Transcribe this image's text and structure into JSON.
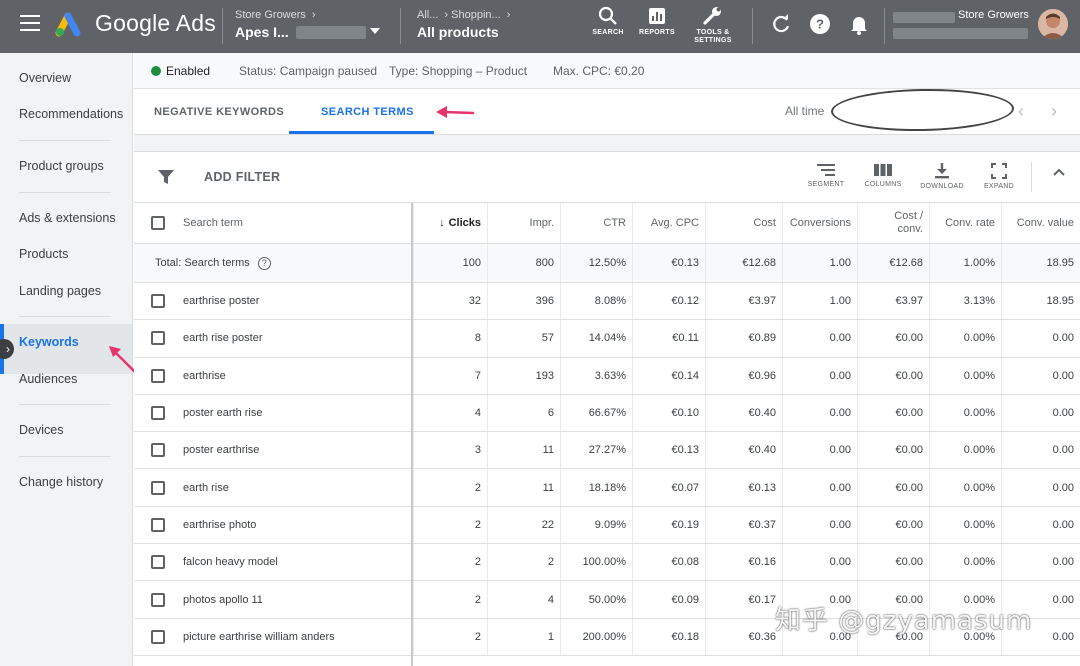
{
  "app": {
    "product_name": "Google Ads",
    "account_parent": "Store Growers",
    "account_name": "Apes I...",
    "campaign_parent": "All...",
    "campaign_child": "Shoppin...",
    "view_title": "All products",
    "user_account": "Store Growers"
  },
  "top_tools": {
    "search": "SEARCH",
    "reports": "REPORTS",
    "tools_line1": "TOOLS &",
    "tools_line2": "SETTINGS"
  },
  "sidebar": {
    "items": [
      {
        "label": "Overview"
      },
      {
        "label": "Recommendations"
      },
      {
        "label": "Product groups"
      },
      {
        "label": "Ads & extensions"
      },
      {
        "label": "Products"
      },
      {
        "label": "Landing pages"
      },
      {
        "label": "Keywords"
      },
      {
        "label": "Audiences"
      },
      {
        "label": "Devices"
      },
      {
        "label": "Change history"
      }
    ],
    "active_index": 6
  },
  "status": {
    "state": "Enabled",
    "status": "Status: Campaign paused",
    "type": "Type: Shopping – Product",
    "max_cpc": "Max. CPC: €0.20"
  },
  "tabs": {
    "negative_keywords": "NEGATIVE KEYWORDS",
    "search_terms": "SEARCH TERMS",
    "date_range": "All time"
  },
  "toolbar": {
    "add_filter": "ADD FILTER",
    "segment": "SEGMENT",
    "columns": "COLUMNS",
    "download": "DOWNLOAD",
    "expand": "EXPAND"
  },
  "table": {
    "headers": {
      "search_term": "Search term",
      "clicks": "Clicks",
      "impr": "Impr.",
      "ctr": "CTR",
      "avg_cpc": "Avg. CPC",
      "cost": "Cost",
      "conversions": "Conversions",
      "cost_conv_1": "Cost /",
      "cost_conv_2": "conv.",
      "conv_rate": "Conv. rate",
      "conv_value": "Conv. value"
    },
    "total": {
      "label": "Total: Search terms",
      "clicks": "100",
      "impr": "800",
      "ctr": "12.50%",
      "avg_cpc": "€0.13",
      "cost": "€12.68",
      "conversions": "1.00",
      "cost_conv": "€12.68",
      "conv_rate": "1.00%",
      "conv_value": "18.95"
    },
    "rows": [
      {
        "term": "earthrise poster",
        "clicks": "32",
        "impr": "396",
        "ctr": "8.08%",
        "avg_cpc": "€0.12",
        "cost": "€3.97",
        "conversions": "1.00",
        "cost_conv": "€3.97",
        "conv_rate": "3.13%",
        "conv_value": "18.95"
      },
      {
        "term": "earth rise poster",
        "clicks": "8",
        "impr": "57",
        "ctr": "14.04%",
        "avg_cpc": "€0.11",
        "cost": "€0.89",
        "conversions": "0.00",
        "cost_conv": "€0.00",
        "conv_rate": "0.00%",
        "conv_value": "0.00"
      },
      {
        "term": "earthrise",
        "clicks": "7",
        "impr": "193",
        "ctr": "3.63%",
        "avg_cpc": "€0.14",
        "cost": "€0.96",
        "conversions": "0.00",
        "cost_conv": "€0.00",
        "conv_rate": "0.00%",
        "conv_value": "0.00"
      },
      {
        "term": "poster earth rise",
        "clicks": "4",
        "impr": "6",
        "ctr": "66.67%",
        "avg_cpc": "€0.10",
        "cost": "€0.40",
        "conversions": "0.00",
        "cost_conv": "€0.00",
        "conv_rate": "0.00%",
        "conv_value": "0.00"
      },
      {
        "term": "poster earthrise",
        "clicks": "3",
        "impr": "11",
        "ctr": "27.27%",
        "avg_cpc": "€0.13",
        "cost": "€0.40",
        "conversions": "0.00",
        "cost_conv": "€0.00",
        "conv_rate": "0.00%",
        "conv_value": "0.00"
      },
      {
        "term": "earth rise",
        "clicks": "2",
        "impr": "11",
        "ctr": "18.18%",
        "avg_cpc": "€0.07",
        "cost": "€0.13",
        "conversions": "0.00",
        "cost_conv": "€0.00",
        "conv_rate": "0.00%",
        "conv_value": "0.00"
      },
      {
        "term": "earthrise photo",
        "clicks": "2",
        "impr": "22",
        "ctr": "9.09%",
        "avg_cpc": "€0.19",
        "cost": "€0.37",
        "conversions": "0.00",
        "cost_conv": "€0.00",
        "conv_rate": "0.00%",
        "conv_value": "0.00"
      },
      {
        "term": "falcon heavy model",
        "clicks": "2",
        "impr": "2",
        "ctr": "100.00%",
        "avg_cpc": "€0.08",
        "cost": "€0.16",
        "conversions": "0.00",
        "cost_conv": "€0.00",
        "conv_rate": "0.00%",
        "conv_value": "0.00"
      },
      {
        "term": "photos apollo 11",
        "clicks": "2",
        "impr": "4",
        "ctr": "50.00%",
        "avg_cpc": "€0.09",
        "cost": "€0.17",
        "conversions": "0.00",
        "cost_conv": "€0.00",
        "conv_rate": "0.00%",
        "conv_value": "0.00"
      },
      {
        "term": "picture earthrise william anders",
        "clicks": "2",
        "impr": "1",
        "ctr": "200.00%",
        "avg_cpc": "€0.18",
        "cost": "€0.36",
        "conversions": "0.00",
        "cost_conv": "€0.00",
        "conv_rate": "0.00%",
        "conv_value": "0.00"
      }
    ]
  },
  "watermark": "知乎 @gzyamasum",
  "colors": {
    "topbar": "#5f6368",
    "accent": "#1a73e8",
    "enabled": "#1e8e3e",
    "annotation": "#e8336b"
  }
}
